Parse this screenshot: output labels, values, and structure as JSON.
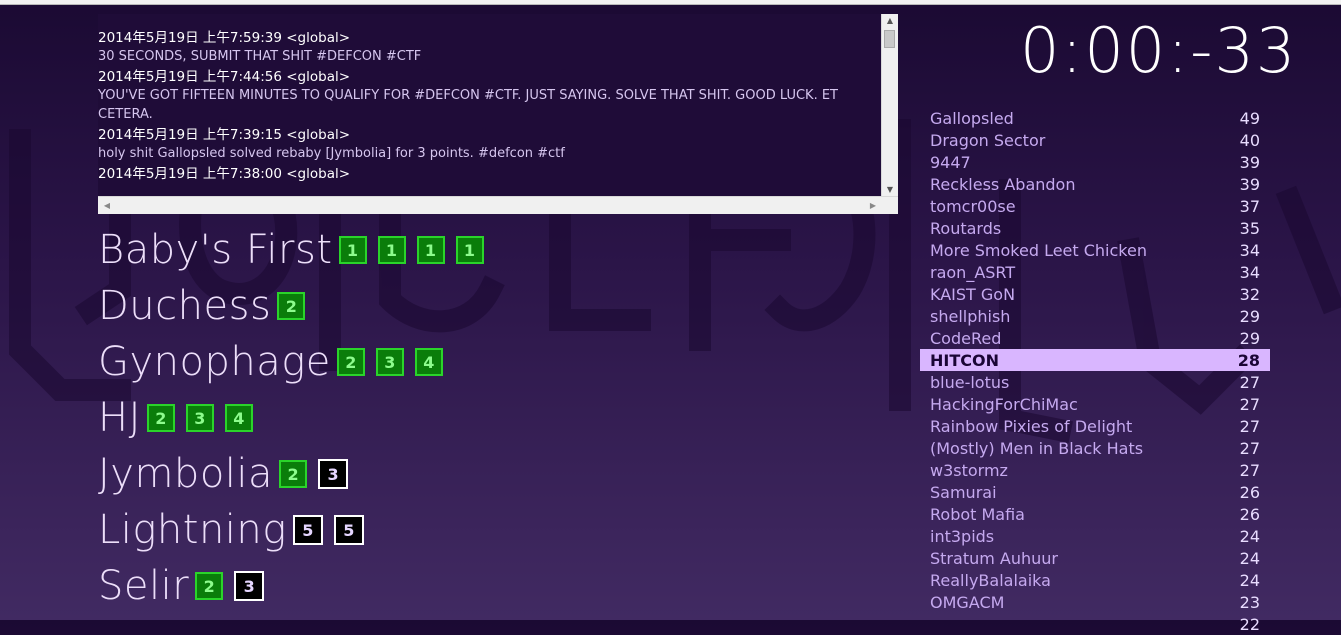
{
  "log": {
    "messages": [
      {
        "header": "2014年5月19日 上午7:59:39 <global>",
        "body": "30 SECONDS, SUBMIT THAT SHIT #DEFCON #CTF"
      },
      {
        "header": "2014年5月19日 上午7:44:56 <global>",
        "body": "YOU'VE GOT FIFTEEN MINUTES TO QUALIFY FOR #DEFCON #CTF. JUST SAYING. SOLVE THAT SHIT. GOOD LUCK. ET CETERA."
      },
      {
        "header": "2014年5月19日 上午7:39:15 <global>",
        "body": "holy shit Gallopsled solved rebaby [Jymbolia] for 3 points. #defcon #ctf"
      },
      {
        "header": "2014年5月19日 上午7:38:00 <global>",
        "body": ""
      }
    ]
  },
  "categories": [
    {
      "name": "Baby's First",
      "challenges": [
        {
          "pts": "1",
          "state": "solved"
        },
        {
          "pts": "1",
          "state": "solved"
        },
        {
          "pts": "1",
          "state": "solved"
        },
        {
          "pts": "1",
          "state": "solved"
        }
      ]
    },
    {
      "name": "Duchess",
      "challenges": [
        {
          "pts": "2",
          "state": "solved"
        }
      ]
    },
    {
      "name": "Gynophage",
      "challenges": [
        {
          "pts": "2",
          "state": "solved"
        },
        {
          "pts": "3",
          "state": "solved"
        },
        {
          "pts": "4",
          "state": "solved"
        }
      ]
    },
    {
      "name": "HJ",
      "challenges": [
        {
          "pts": "2",
          "state": "solved"
        },
        {
          "pts": "3",
          "state": "solved"
        },
        {
          "pts": "4",
          "state": "solved"
        }
      ]
    },
    {
      "name": "Jymbolia",
      "challenges": [
        {
          "pts": "2",
          "state": "solved"
        },
        {
          "pts": "3",
          "state": "open"
        }
      ]
    },
    {
      "name": "Lightning",
      "challenges": [
        {
          "pts": "5",
          "state": "open"
        },
        {
          "pts": "5",
          "state": "open"
        }
      ]
    },
    {
      "name": "Selir",
      "challenges": [
        {
          "pts": "2",
          "state": "solved"
        },
        {
          "pts": "3",
          "state": "open"
        }
      ]
    }
  ],
  "timer": "0:00:-33",
  "scoreboard": [
    {
      "team": "Gallopsled",
      "score": "49"
    },
    {
      "team": "Dragon Sector",
      "score": "40"
    },
    {
      "team": "9447",
      "score": "39"
    },
    {
      "team": "Reckless Abandon",
      "score": "39"
    },
    {
      "team": "tomcr00se",
      "score": "37"
    },
    {
      "team": "Routards",
      "score": "35"
    },
    {
      "team": "More Smoked Leet Chicken",
      "score": "34"
    },
    {
      "team": "raon_ASRT",
      "score": "34"
    },
    {
      "team": "KAIST GoN",
      "score": "32"
    },
    {
      "team": "shellphish",
      "score": "29"
    },
    {
      "team": "CodeRed",
      "score": "29"
    },
    {
      "team": "HITCON",
      "score": "28",
      "highlight": true
    },
    {
      "team": "blue-lotus",
      "score": "27"
    },
    {
      "team": "HackingForChiMac",
      "score": "27"
    },
    {
      "team": "Rainbow Pixies of Delight",
      "score": "27"
    },
    {
      "team": "(Mostly) Men in Black Hats",
      "score": "27"
    },
    {
      "team": "w3stormz",
      "score": "27"
    },
    {
      "team": "Samurai",
      "score": "26"
    },
    {
      "team": "Robot Mafia",
      "score": "26"
    },
    {
      "team": "int3pids",
      "score": "24"
    },
    {
      "team": "Stratum Auhuur",
      "score": "24"
    },
    {
      "team": "ReallyBalalaika",
      "score": "24"
    },
    {
      "team": "OMGACM",
      "score": "23"
    },
    {
      "team": "",
      "score": "22"
    }
  ],
  "colors": {
    "solved_bg": "#0a7d0a",
    "solved_border": "#2ad42a",
    "open_bg": "#000000",
    "highlight_row": "#d9b6ff"
  },
  "icons": {
    "scroll_up": "arrow-up-icon",
    "scroll_down": "arrow-down-icon",
    "scroll_left": "arrow-left-icon",
    "scroll_right": "arrow-right-icon"
  }
}
